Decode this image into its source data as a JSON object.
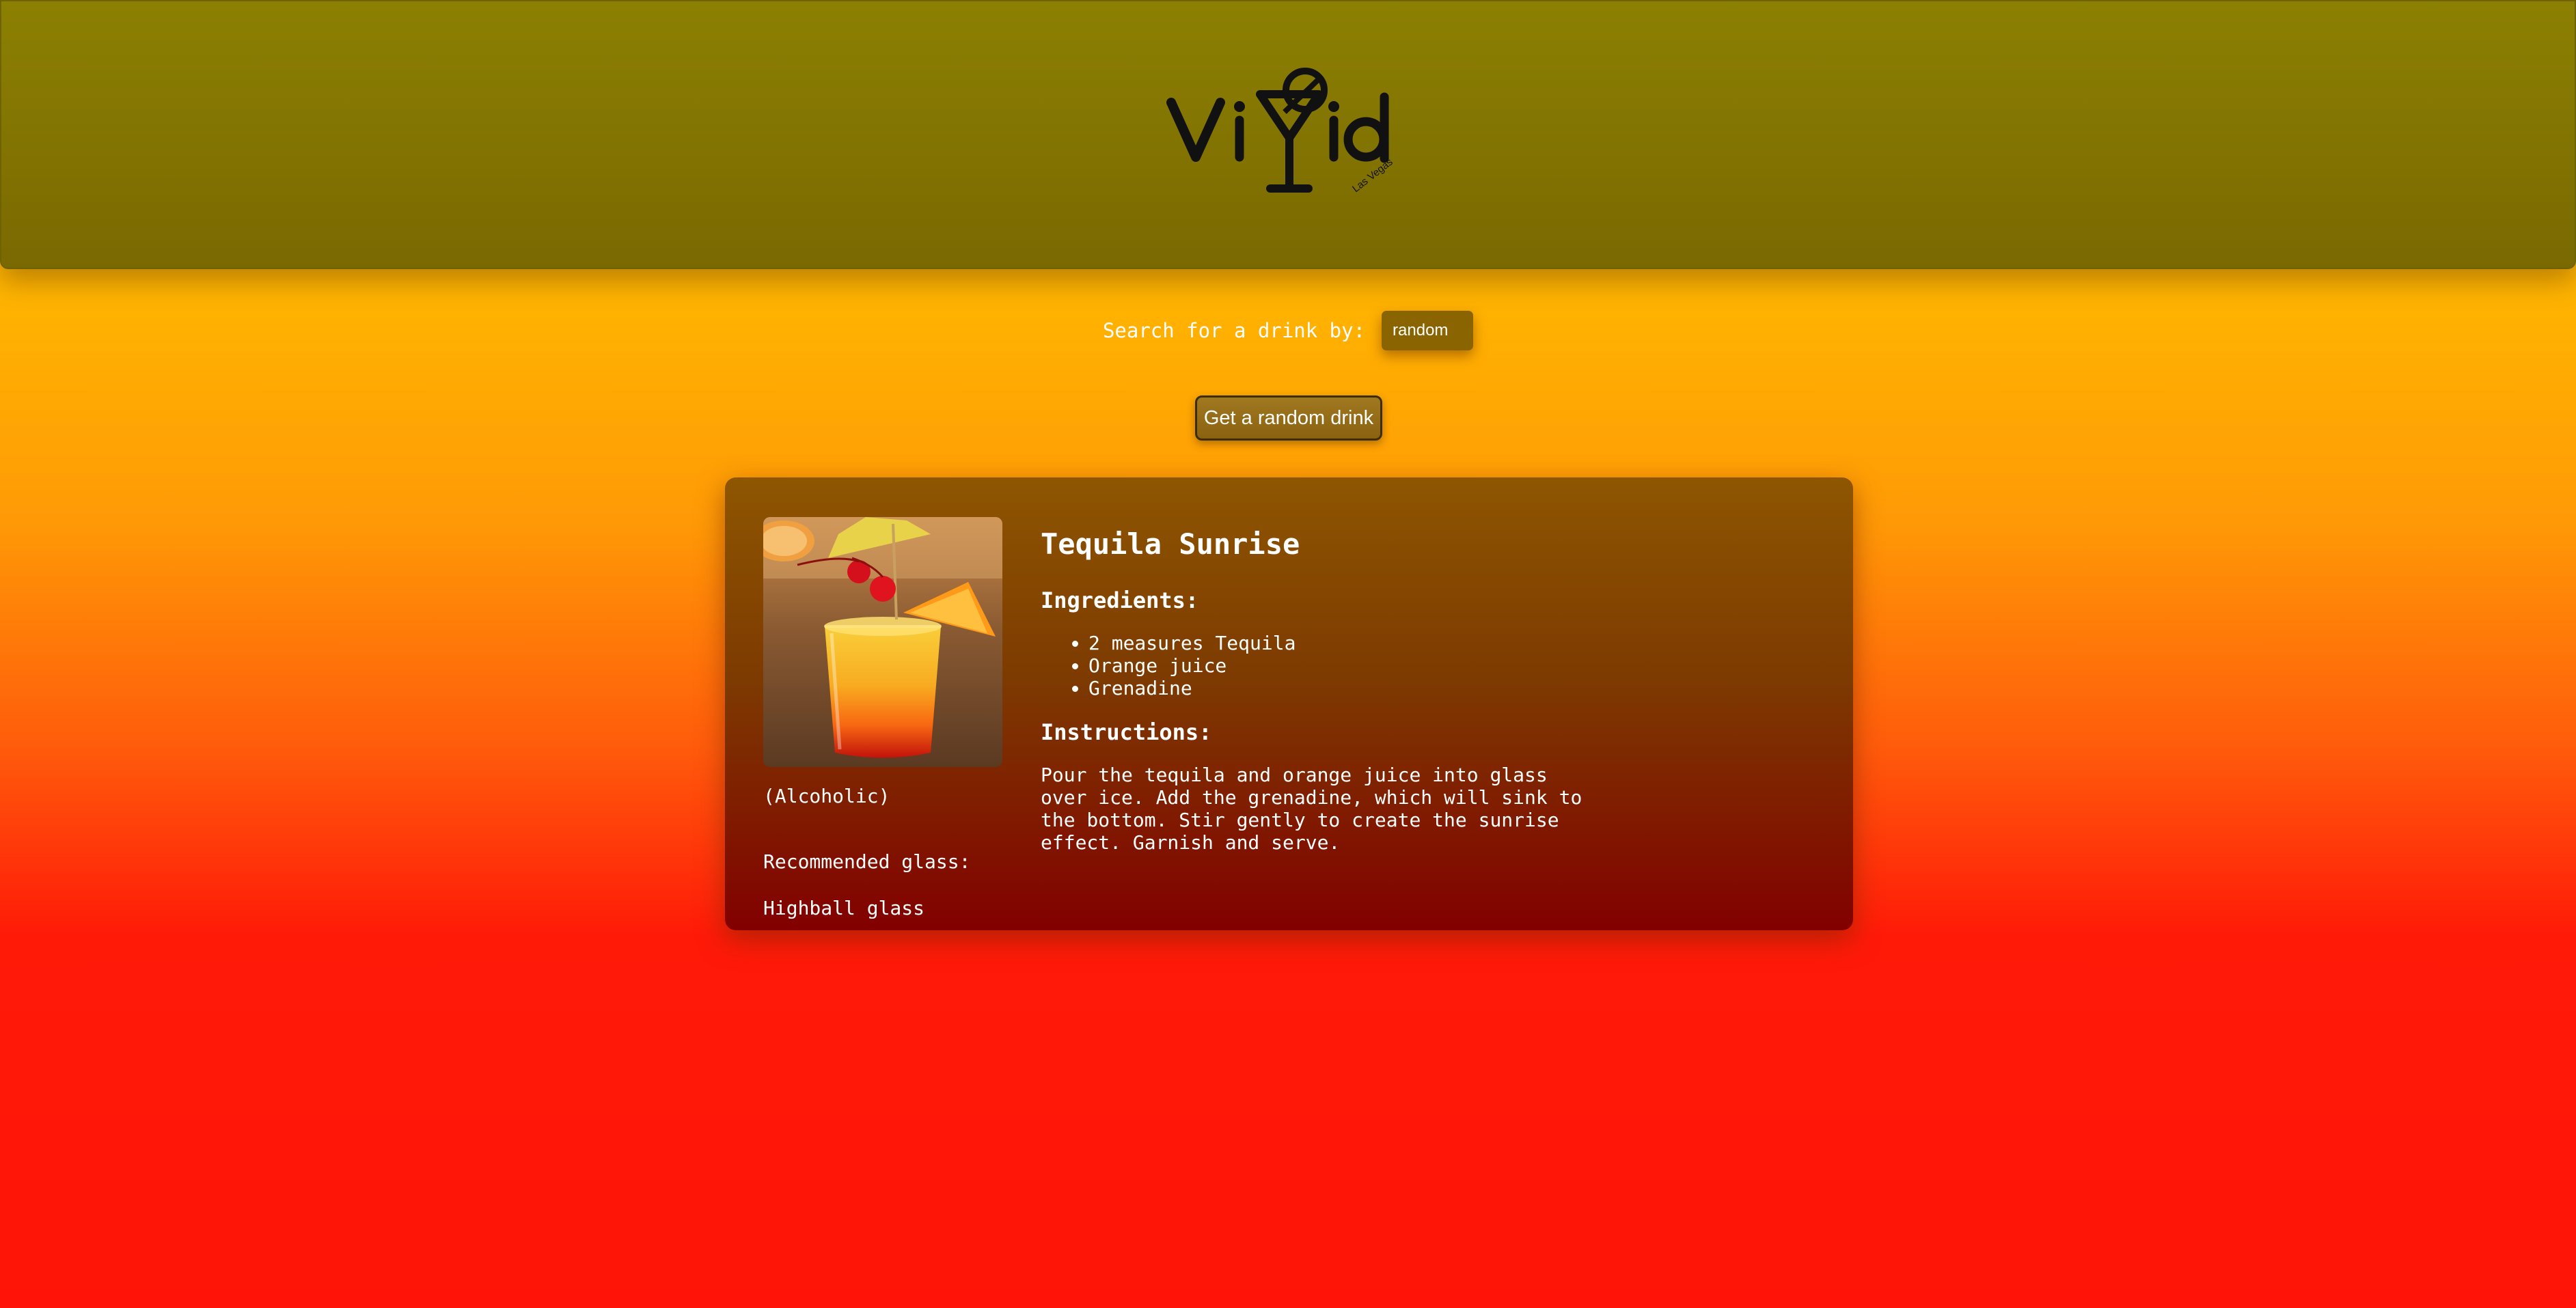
{
  "header": {
    "logo_text": "Vivid",
    "logo_subtext": "Las Vegas"
  },
  "search": {
    "label": "Search for a drink by:",
    "selected_option": "random"
  },
  "random_button": {
    "label": "Get a random drink"
  },
  "drink": {
    "name": "Tequila Sunrise",
    "ingredients_heading": "Ingredients:",
    "ingredients": [
      "2 measures Tequila",
      "Orange juice",
      "Grenadine"
    ],
    "instructions_heading": "Instructions:",
    "instructions": "Pour the tequila and orange juice into glass over ice. Add the grenadine, which will sink to the bottom. Stir gently to create the sunrise effect. Garnish and serve.",
    "category": "(Alcoholic)",
    "glass_label": "Recommended glass:",
    "glass": "Highball glass"
  },
  "colors": {
    "header_bg": "#8c8002",
    "page_top": "#ffb400",
    "page_bottom": "#ff1308",
    "card_top": "#8e5601",
    "card_bottom": "#820000",
    "button_bg": "#9a7218"
  }
}
